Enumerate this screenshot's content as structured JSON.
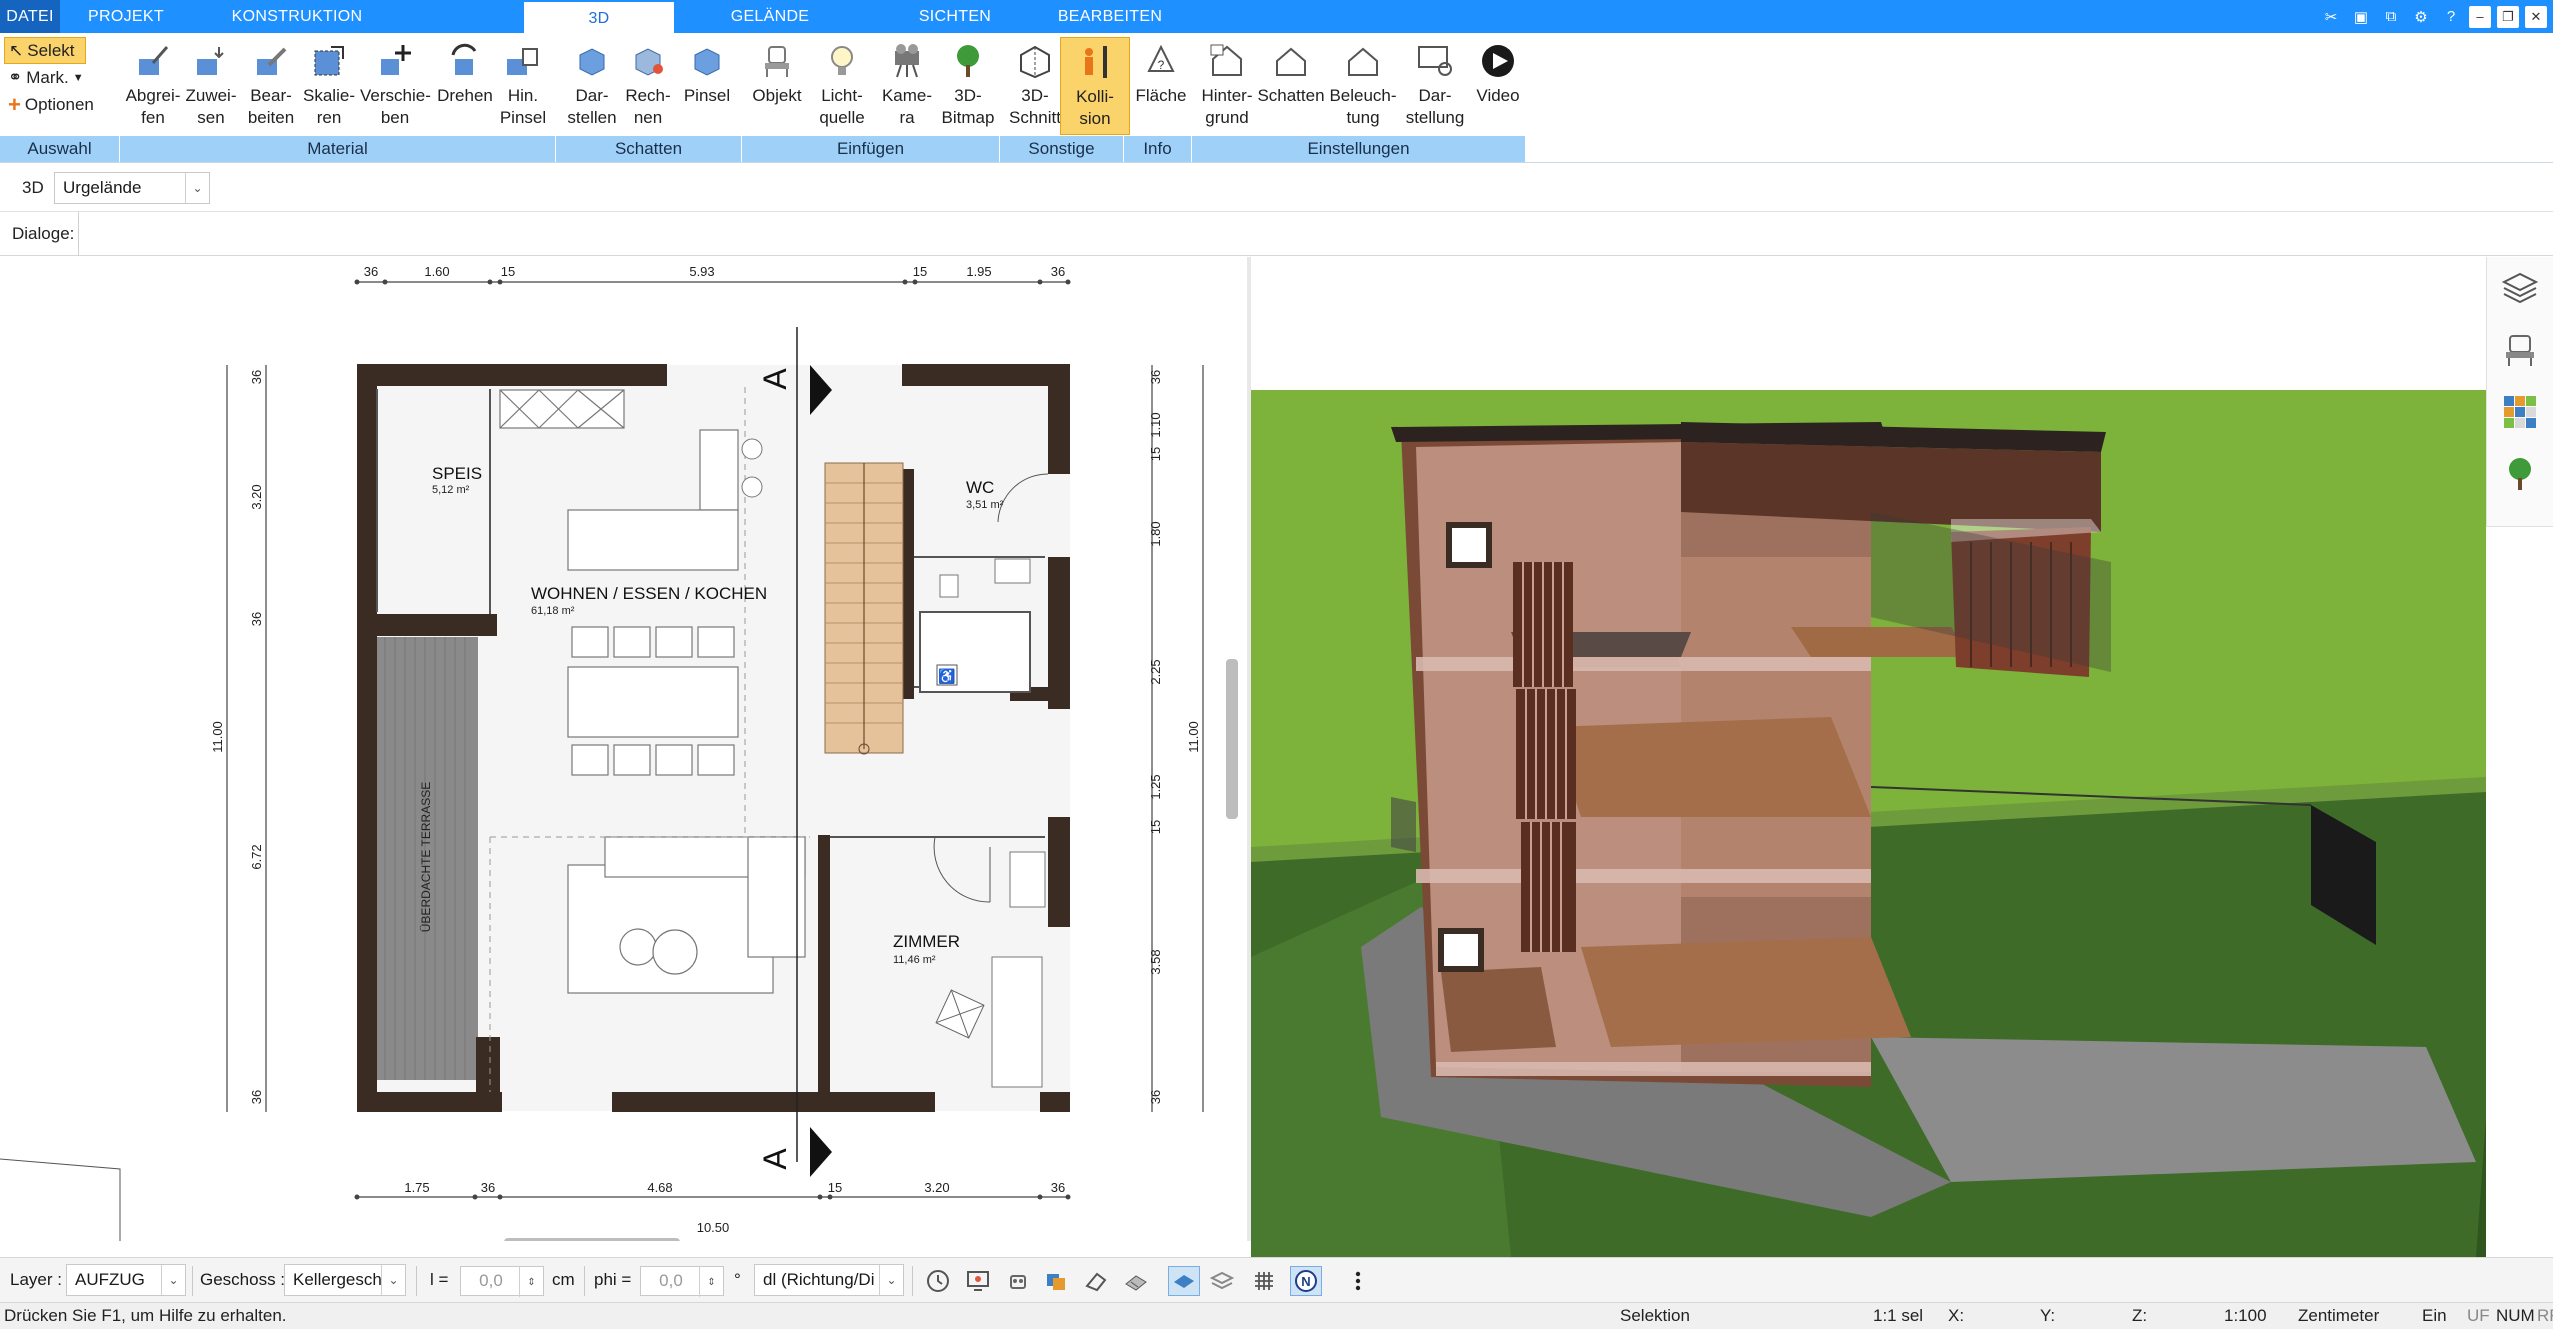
{
  "tabs": [
    {
      "label": "DATEI"
    },
    {
      "label": "PROJEKT"
    },
    {
      "label": "KONSTRUKTION"
    },
    {
      "label": "3D"
    },
    {
      "label": "GELÄNDE"
    },
    {
      "label": "SICHTEN"
    },
    {
      "label": "BEARBEITEN"
    }
  ],
  "selection": {
    "selekt": "Selekt",
    "mark": "Mark.",
    "optionen": "Optionen"
  },
  "ribbon_buttons": [
    {
      "line1": "Abgrei-",
      "line2": "fen",
      "icon": "eyedropper-icon"
    },
    {
      "line1": "Zuwei-",
      "line2": "sen",
      "icon": "assign-icon"
    },
    {
      "line1": "Bear-",
      "line2": "beiten",
      "icon": "edit-material-icon"
    },
    {
      "line1": "Skalie-",
      "line2": "ren",
      "icon": "scale-icon"
    },
    {
      "line1": "Verschie-",
      "line2": "ben",
      "icon": "move-icon"
    },
    {
      "line1": "Drehen",
      "line2": "",
      "icon": "rotate-icon"
    },
    {
      "line1": "Hin.",
      "line2": "Pinsel",
      "icon": "back-brush-icon"
    },
    {
      "line1": "Dar-",
      "line2": "stellen",
      "icon": "shadow-display-icon"
    },
    {
      "line1": "Rech-",
      "line2": "nen",
      "icon": "shadow-calc-icon"
    },
    {
      "line1": "Pinsel",
      "line2": "",
      "icon": "shadow-brush-icon"
    },
    {
      "line1": "Objekt",
      "line2": "",
      "icon": "chair-icon"
    },
    {
      "line1": "Licht-",
      "line2": "quelle",
      "icon": "lightbulb-icon"
    },
    {
      "line1": "Kame-",
      "line2": "ra",
      "icon": "camera-icon"
    },
    {
      "line1": "3D-",
      "line2": "Bitmap",
      "icon": "tree-icon"
    },
    {
      "line1": "3D-",
      "line2": "Schnitt",
      "icon": "section-cut-icon"
    },
    {
      "line1": "Kolli-",
      "line2": "sion",
      "icon": "collision-icon"
    },
    {
      "line1": "Fläche",
      "line2": "",
      "icon": "area-icon"
    },
    {
      "line1": "Hinter-",
      "line2": "grund",
      "icon": "background-icon"
    },
    {
      "line1": "Schatten",
      "line2": "",
      "icon": "house-shadow-icon"
    },
    {
      "line1": "Beleuch-",
      "line2": "tung",
      "icon": "house-light-icon"
    },
    {
      "line1": "Dar-",
      "line2": "stellung",
      "icon": "display-settings-icon"
    },
    {
      "line1": "Video",
      "line2": "",
      "icon": "play-icon"
    }
  ],
  "ribbon_groups": [
    "Auswahl",
    "Material",
    "Schatten",
    "Einfügen",
    "Sonstige",
    "Info",
    "Einstellungen"
  ],
  "view_bar": {
    "mode": "3D",
    "terrain": "Urgelände"
  },
  "dialog_bar": {
    "label": "Dialoge:"
  },
  "plan": {
    "dims_top": [
      "36",
      "1.60",
      "15",
      "5.93",
      "15",
      "1.95",
      "36"
    ],
    "dims_bottom": [
      "1.75",
      "36",
      "4.68",
      "15",
      "3.20",
      "36"
    ],
    "dims_bottom_total": "10.50",
    "dims_left": [
      "36",
      "3.20",
      "36",
      "6.72",
      "36"
    ],
    "dims_left_total": "11.00",
    "dims_right": [
      "36",
      "1.10",
      "15",
      "1.80",
      "2.25",
      "15",
      "1.25",
      "3.58",
      "36"
    ],
    "dims_right_total": "11.00",
    "section_marker": "A",
    "rooms": [
      {
        "name": "SPEIS",
        "area": "5,12 m²"
      },
      {
        "name": "WC",
        "area": "3,51 m²"
      },
      {
        "name": "WOHNEN / ESSEN / KOCHEN",
        "area": "61,18 m²"
      },
      {
        "name": "ZIMMER",
        "area": "11,46 m²"
      },
      {
        "name": "ÜBERDACHTE TERRASSE",
        "area": ""
      }
    ]
  },
  "bottom_bar": {
    "layer_label": "Layer :",
    "layer_value": "AUFZUG",
    "geschoss_label": "Geschoss :",
    "geschoss_value": "Kellergesch",
    "l_label": "l =",
    "l_value": "0,0",
    "l_unit": "cm",
    "phi_label": "phi =",
    "phi_value": "0,0",
    "phi_unit": "°",
    "direction_value": "dl (Richtung/Di"
  },
  "status": {
    "help": "Drücken Sie F1, um Hilfe zu erhalten.",
    "mode": "Selektion",
    "sel": "1:1 sel",
    "x": "X:",
    "y": "Y:",
    "z": "Z:",
    "scale": "1:100",
    "unit": "Zentimeter",
    "ein": "Ein",
    "uf": "UF",
    "num": "NUM",
    "rf": "RF"
  },
  "colors": {
    "accent": "#1e90ff",
    "group_band": "#9fd0f7",
    "highlight": "#fbd36b",
    "wall": "#3a2b23",
    "grass": "#3a6b26",
    "wood": "#8a4e32"
  }
}
